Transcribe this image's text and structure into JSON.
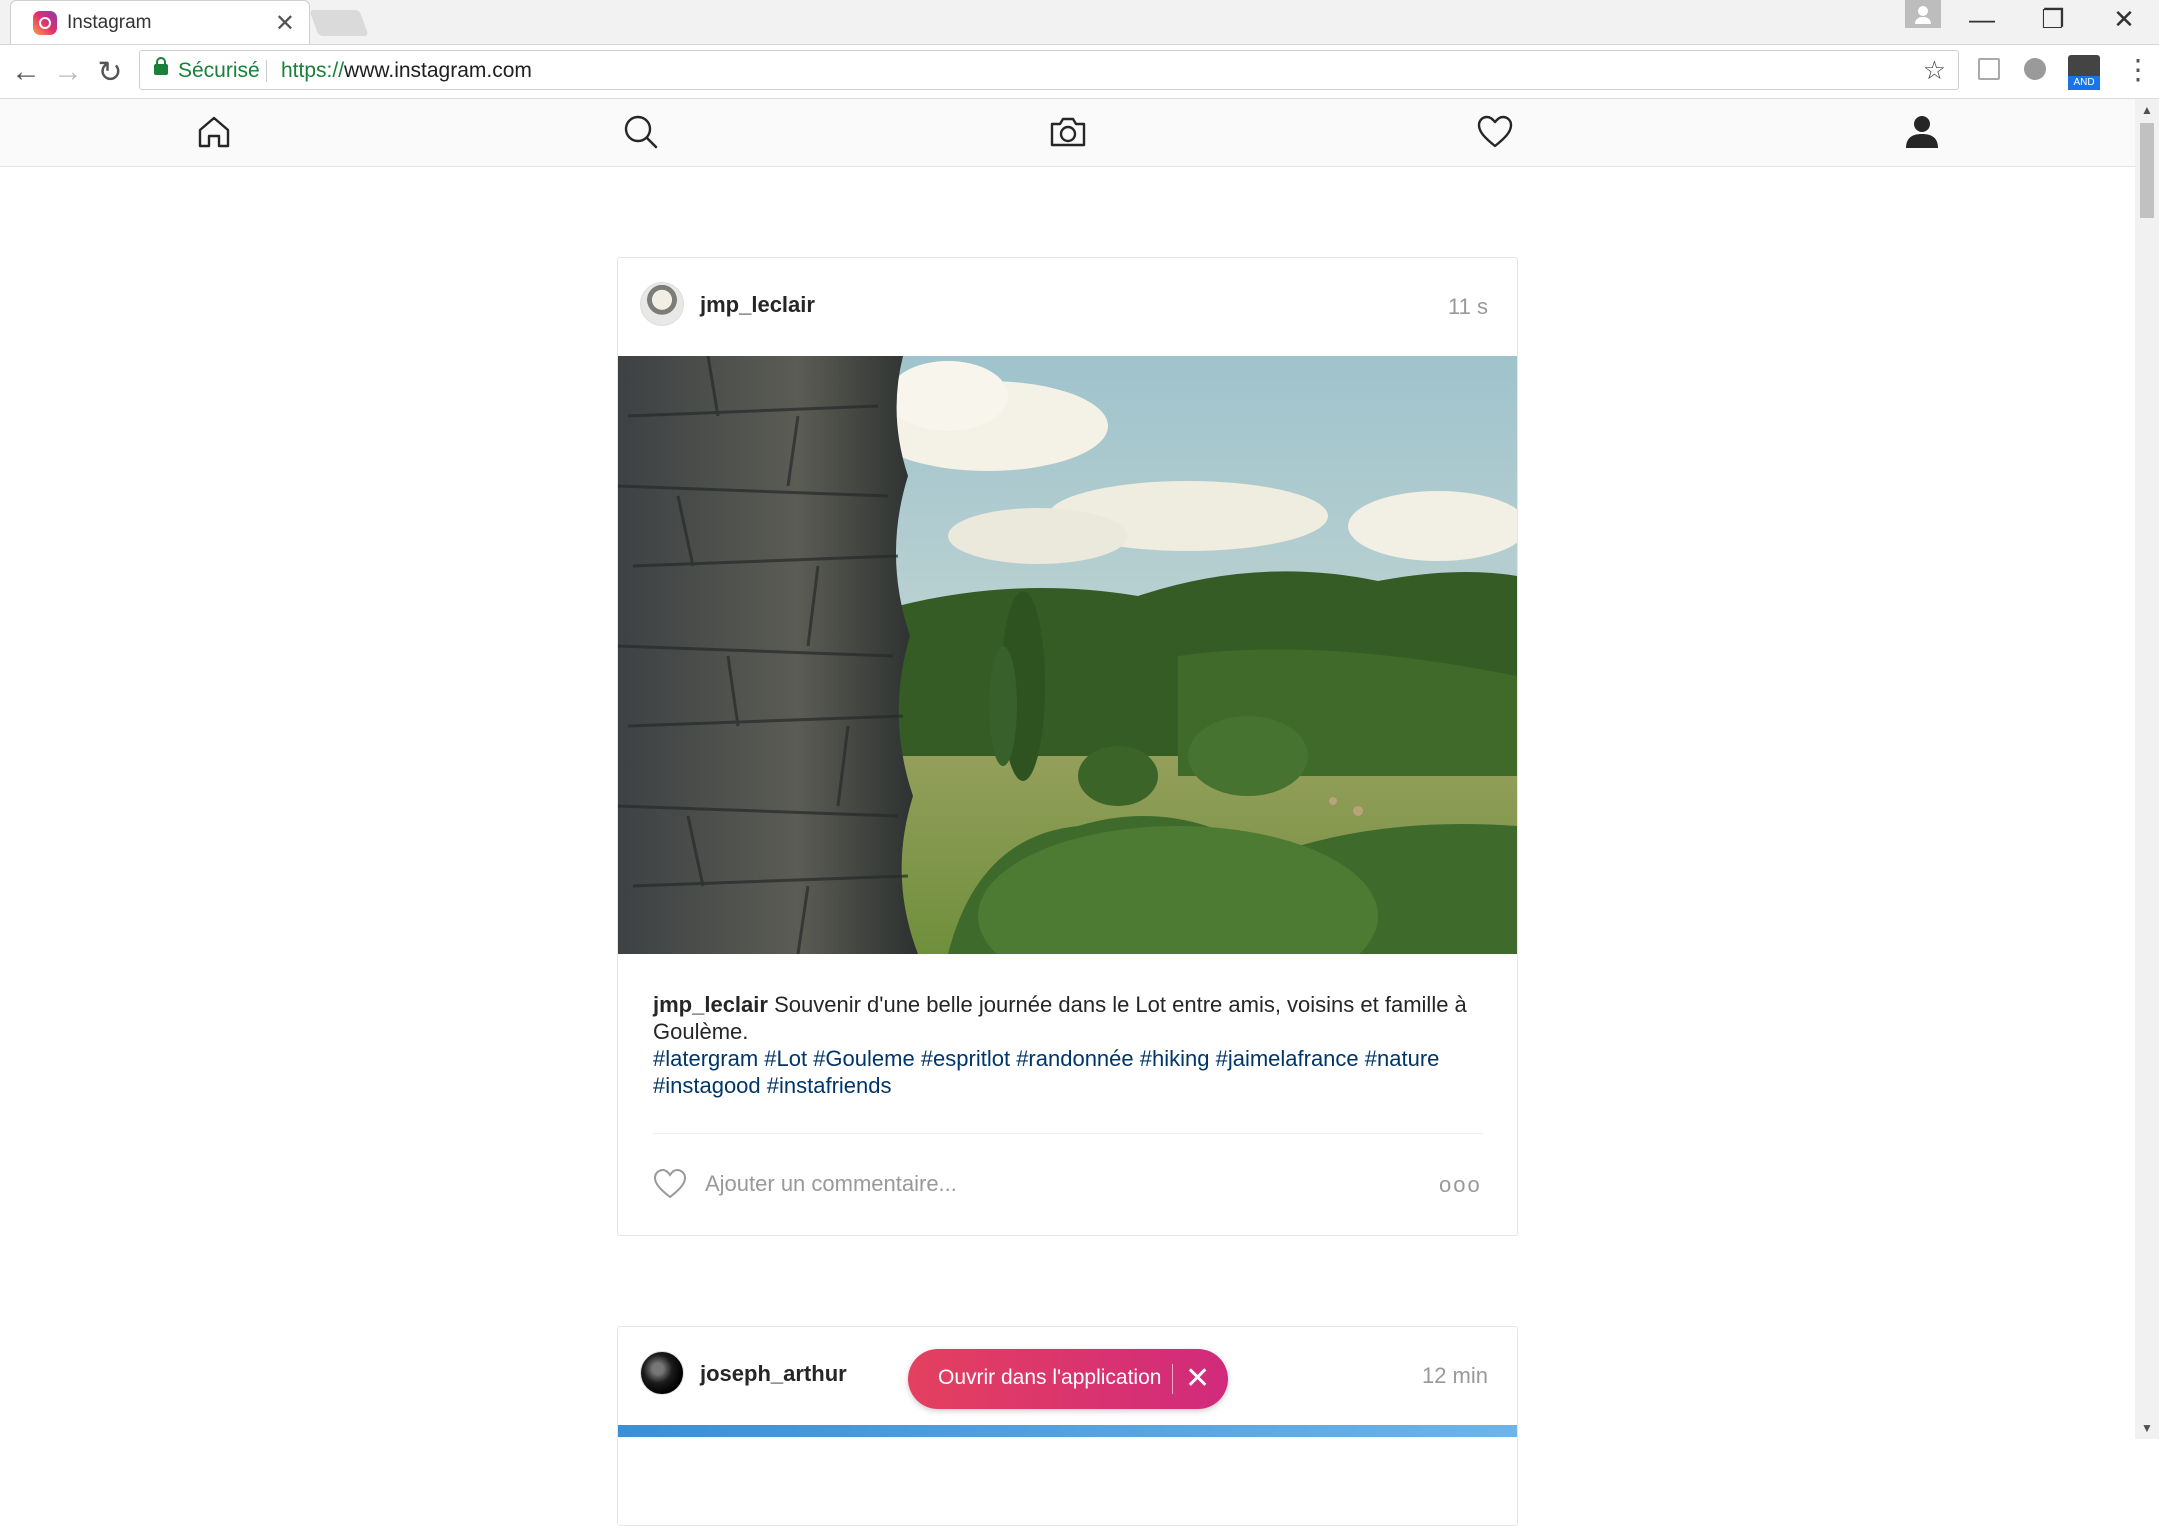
{
  "browser": {
    "tab_title": "Instagram",
    "tab_close": "✕",
    "window_controls": {
      "minimize": "—",
      "restore": "❐",
      "close": "✕"
    },
    "nav": {
      "back": "←",
      "forward": "→",
      "reload": "↻"
    },
    "secure_label": "Sécurisé",
    "url_scheme": "https://",
    "url_host": "www.instagram.com",
    "star": "☆",
    "extension_badge": "AND",
    "menu": "⋮"
  },
  "ig_nav": {
    "items": [
      {
        "name": "home",
        "icon": "home-icon"
      },
      {
        "name": "search",
        "icon": "search-icon"
      },
      {
        "name": "camera",
        "icon": "camera-icon"
      },
      {
        "name": "activity",
        "icon": "heart-icon"
      },
      {
        "name": "profile",
        "icon": "profile-icon"
      }
    ]
  },
  "feed": {
    "post1": {
      "username": "jmp_leclair",
      "time": "11 s",
      "caption_user": "jmp_leclair",
      "caption_text": "Souvenir d'une belle journée dans le Lot entre amis, voisins et famille à Goulème.",
      "hashtags": "#latergram #Lot #Gouleme #espritlot #randonnée #hiking #jaimelafrance #nature #instagood #instafriends",
      "comment_placeholder": "Ajouter un commentaire...",
      "more": "ooo"
    },
    "post2": {
      "username": "joseph_arthur",
      "time": "12 min"
    }
  },
  "open_in_app": {
    "label": "Ouvrir dans l'application",
    "close": "✕"
  },
  "colors": {
    "secure_green": "#188038",
    "hashtag_blue": "#003569",
    "pill_gradient_start": "#e4405f",
    "pill_gradient_end": "#d12a7c"
  }
}
